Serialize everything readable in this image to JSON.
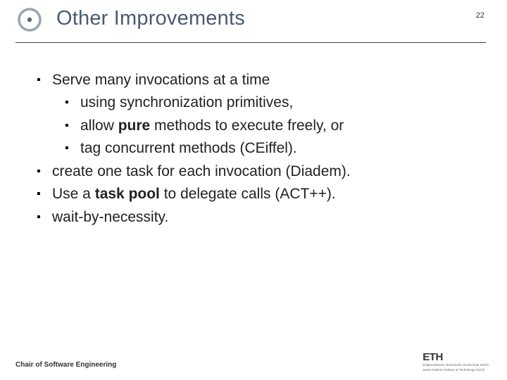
{
  "header": {
    "title": "Other Improvements",
    "page_number": "22"
  },
  "bullets": [
    {
      "level": 1,
      "parts": [
        {
          "t": "Serve many invocations at a time",
          "b": false
        }
      ]
    },
    {
      "level": 2,
      "parts": [
        {
          "t": "using synchronization primitives,",
          "b": false
        }
      ]
    },
    {
      "level": 2,
      "parts": [
        {
          "t": "allow ",
          "b": false
        },
        {
          "t": "pure",
          "b": true
        },
        {
          "t": " methods to execute freely, or",
          "b": false
        }
      ]
    },
    {
      "level": 2,
      "parts": [
        {
          "t": "tag concurrent methods (CEiffel).",
          "b": false
        }
      ]
    },
    {
      "level": 1,
      "parts": [
        {
          "t": "create one task for each invocation (Diadem).",
          "b": false
        }
      ]
    },
    {
      "level": 1,
      "parts": [
        {
          "t": "Use a ",
          "b": false
        },
        {
          "t": "task pool",
          "b": true
        },
        {
          "t": " to delegate calls (ACT++).",
          "b": false
        }
      ]
    },
    {
      "level": 1,
      "parts": [
        {
          "t": "wait-by-necessity.",
          "b": false
        }
      ]
    }
  ],
  "footer": {
    "chair": "Chair of Software Engineering",
    "logo_main": "ETH",
    "logo_sub1": "Eidgenössische Technische Hochschule Zürich",
    "logo_sub2": "Swiss Federal Institute of Technology Zurich"
  }
}
